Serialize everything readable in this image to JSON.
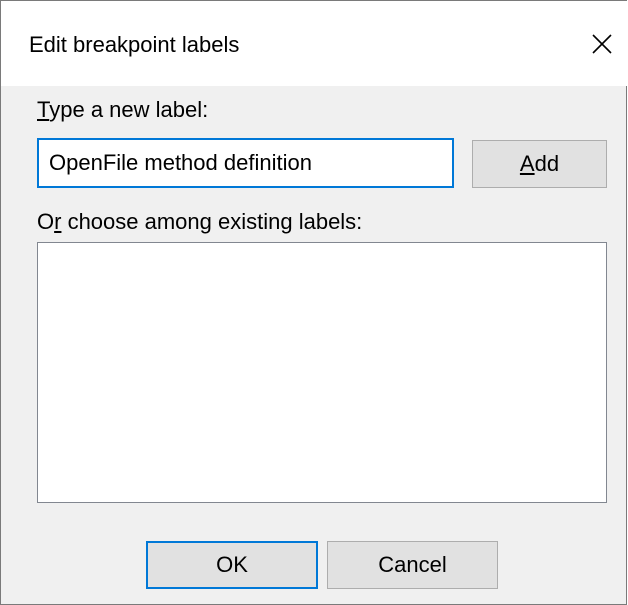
{
  "dialog": {
    "title": "Edit breakpoint labels",
    "close_icon": "close-icon"
  },
  "new_label": {
    "label_accel": "T",
    "label_rest": "ype a new label:",
    "value": "OpenFile method definition"
  },
  "add_button": {
    "label_accel": "A",
    "label_rest": "dd"
  },
  "existing_labels": {
    "label_pre": "O",
    "label_accel": "r",
    "label_rest": " choose among existing labels:",
    "items": []
  },
  "footer": {
    "ok_label": "OK",
    "cancel_label": "Cancel"
  },
  "colors": {
    "accent": "#0078d7",
    "dialog_bg": "#f0f0f0",
    "button_bg": "#e1e1e1"
  }
}
